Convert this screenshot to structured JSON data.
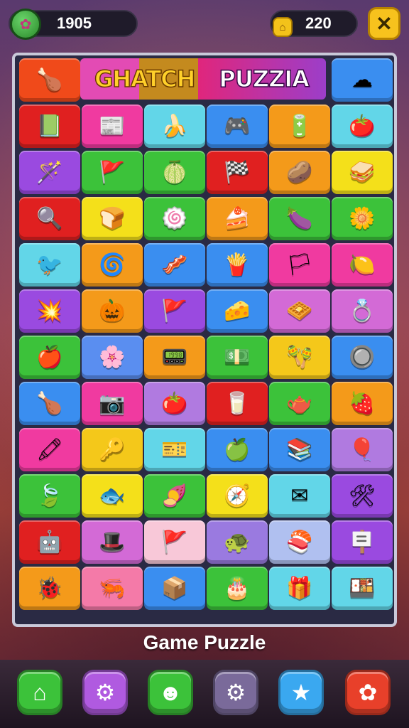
{
  "header": {
    "score": "1905",
    "coins": "220"
  },
  "board": {
    "title_left": "GHATCH",
    "title_right": "PUZZIA",
    "rows": [
      [
        {
          "name": "drumstick-icon",
          "glyph": "🍗",
          "bg": "#f04a1a"
        },
        null,
        null,
        null,
        null,
        {
          "name": "cloud-icon",
          "glyph": "☁",
          "bg": "#3a8ef0"
        }
      ],
      [
        {
          "name": "book-icon",
          "glyph": "📗",
          "bg": "#e02020"
        },
        {
          "name": "newspaper-icon",
          "glyph": "📰",
          "bg": "#f03aa0"
        },
        {
          "name": "banana-icon",
          "glyph": "🍌",
          "bg": "#62d6e8"
        },
        {
          "name": "gamepad-icon",
          "glyph": "🎮",
          "bg": "#3a8ef0"
        },
        {
          "name": "battery-icon",
          "glyph": "🔋",
          "bg": "#f49a1a"
        },
        {
          "name": "tomato-icon",
          "glyph": "🍅",
          "bg": "#62d6e8"
        }
      ],
      [
        {
          "name": "wand-icon",
          "glyph": "🪄",
          "bg": "#9a4ae0"
        },
        {
          "name": "flag-icon",
          "glyph": "🚩",
          "bg": "#3cc23a"
        },
        {
          "name": "melon-icon",
          "glyph": "🍈",
          "bg": "#3cc23a"
        },
        {
          "name": "flag-icon",
          "glyph": "🏁",
          "bg": "#e02020"
        },
        {
          "name": "potato-icon",
          "glyph": "🥔",
          "bg": "#f49a1a"
        },
        {
          "name": "sandwich-icon",
          "glyph": "🥪",
          "bg": "#f4e01a"
        }
      ],
      [
        {
          "name": "mirror-icon",
          "glyph": "🔍",
          "bg": "#e02020"
        },
        {
          "name": "bread-icon",
          "glyph": "🍞",
          "bg": "#f4e01a"
        },
        {
          "name": "blob-icon",
          "glyph": "🍥",
          "bg": "#3cc23a"
        },
        {
          "name": "cake-slice-icon",
          "glyph": "🍰",
          "bg": "#f49a1a"
        },
        {
          "name": "eggplant-icon",
          "glyph": "🍆",
          "bg": "#3cc23a"
        },
        {
          "name": "flower-icon",
          "glyph": "🌼",
          "bg": "#3cc23a"
        }
      ],
      [
        {
          "name": "bird-icon",
          "glyph": "🐦",
          "bg": "#62d6e8"
        },
        {
          "name": "wreath-icon",
          "glyph": "🌀",
          "bg": "#f49a1a"
        },
        {
          "name": "bacon-icon",
          "glyph": "🥓",
          "bg": "#3a8ef0"
        },
        {
          "name": "fries-icon",
          "glyph": "🍟",
          "bg": "#3a8ef0"
        },
        {
          "name": "flag-icon",
          "glyph": "🏳",
          "bg": "#f03aa0"
        },
        {
          "name": "lemon-icon",
          "glyph": "🍋",
          "bg": "#f03aa0"
        }
      ],
      [
        {
          "name": "star-burst-icon",
          "glyph": "💥",
          "bg": "#9a4ae0"
        },
        {
          "name": "pumpkin-icon",
          "glyph": "🎃",
          "bg": "#f49a1a"
        },
        {
          "name": "flag-icon",
          "glyph": "🚩",
          "bg": "#9a4ae0"
        },
        {
          "name": "cheese-icon",
          "glyph": "🧀",
          "bg": "#3a8ef0"
        },
        {
          "name": "waffle-icon",
          "glyph": "🧇",
          "bg": "#d36ad6"
        },
        {
          "name": "ring-icon",
          "glyph": "💍",
          "bg": "#d36ad6"
        }
      ],
      [
        {
          "name": "apple-icon",
          "glyph": "🍎",
          "bg": "#3cc23a"
        },
        {
          "name": "gear-flower-icon",
          "glyph": "🌸",
          "bg": "#5a8ef0"
        },
        {
          "name": "tablet-icon",
          "glyph": "📟",
          "bg": "#f49a1a"
        },
        {
          "name": "money-icon",
          "glyph": "💵",
          "bg": "#3cc23a"
        },
        {
          "name": "maracas-icon",
          "glyph": "🪇",
          "bg": "#f4c81a"
        },
        {
          "name": "button-icon",
          "glyph": "🔘",
          "bg": "#3a8ef0"
        }
      ],
      [
        {
          "name": "chicken-leg-icon",
          "glyph": "🍗",
          "bg": "#3a8ef0"
        },
        {
          "name": "camera-icon",
          "glyph": "📷",
          "bg": "#f03aa0"
        },
        {
          "name": "tomato-icon",
          "glyph": "🍅",
          "bg": "#b07ae0"
        },
        {
          "name": "cup-icon",
          "glyph": "🥛",
          "bg": "#e02020"
        },
        {
          "name": "blender-icon",
          "glyph": "🫖",
          "bg": "#3cc23a"
        },
        {
          "name": "berries-icon",
          "glyph": "🍓",
          "bg": "#f49a1a"
        }
      ],
      [
        {
          "name": "crayon-icon",
          "glyph": "🖍",
          "bg": "#f03aa0"
        },
        {
          "name": "key-icon",
          "glyph": "🔑",
          "bg": "#f4c81a"
        },
        {
          "name": "ticket-icon",
          "glyph": "🎫",
          "bg": "#62d6e8"
        },
        {
          "name": "lime-icon",
          "glyph": "🍏",
          "bg": "#3a8ef0"
        },
        {
          "name": "books-icon",
          "glyph": "📚",
          "bg": "#3a8ef0"
        },
        {
          "name": "balloon-icon",
          "glyph": "🎈",
          "bg": "#b07ae0"
        }
      ],
      [
        {
          "name": "leaf-icon",
          "glyph": "🍃",
          "bg": "#3cc23a"
        },
        {
          "name": "fish-icon",
          "glyph": "🐟",
          "bg": "#f4e01a"
        },
        {
          "name": "sweet-potato-icon",
          "glyph": "🍠",
          "bg": "#3cc23a"
        },
        {
          "name": "compass-icon",
          "glyph": "🧭",
          "bg": "#f4e01a"
        },
        {
          "name": "envelope-icon",
          "glyph": "✉",
          "bg": "#62d6e8"
        },
        {
          "name": "tools-icon",
          "glyph": "🛠",
          "bg": "#9a4ae0"
        }
      ],
      [
        {
          "name": "robot-icon",
          "glyph": "🤖",
          "bg": "#e02020"
        },
        {
          "name": "hat-icon",
          "glyph": "🎩",
          "bg": "#d36ad6"
        },
        {
          "name": "flag-icon",
          "glyph": "🚩",
          "bg": "#f8c8d8"
        },
        {
          "name": "turtle-icon",
          "glyph": "🐢",
          "bg": "#9a7ae0"
        },
        {
          "name": "sushi-icon",
          "glyph": "🍣",
          "bg": "#b0c0f0"
        },
        {
          "name": "sign-icon",
          "glyph": "🪧",
          "bg": "#9a4ae0"
        }
      ],
      [
        {
          "name": "bug-icon",
          "glyph": "🐞",
          "bg": "#f49a1a"
        },
        {
          "name": "shrimp-icon",
          "glyph": "🦐",
          "bg": "#f47aa8"
        },
        {
          "name": "box-icon",
          "glyph": "📦",
          "bg": "#3a8ef0"
        },
        {
          "name": "cake-icon",
          "glyph": "🎂",
          "bg": "#3cc23a"
        },
        {
          "name": "gift-icon",
          "glyph": "🎁",
          "bg": "#62d6e8"
        },
        {
          "name": "toaster-icon",
          "glyph": "🍱",
          "bg": "#62d6e8"
        }
      ]
    ]
  },
  "caption": "Game Puzzle",
  "nav": [
    {
      "name": "home-icon",
      "glyph": "⌂",
      "bg": "#3cc23a"
    },
    {
      "name": "settings-icon",
      "glyph": "⚙",
      "bg": "#b05ae0"
    },
    {
      "name": "character-icon",
      "glyph": "☻",
      "bg": "#3cc23a"
    },
    {
      "name": "search-gear-icon",
      "glyph": "⚙",
      "bg": "#7a6a9a"
    },
    {
      "name": "star-icon",
      "glyph": "★",
      "bg": "#3aa8f0"
    },
    {
      "name": "cog-icon",
      "glyph": "✿",
      "bg": "#e8402a"
    }
  ]
}
